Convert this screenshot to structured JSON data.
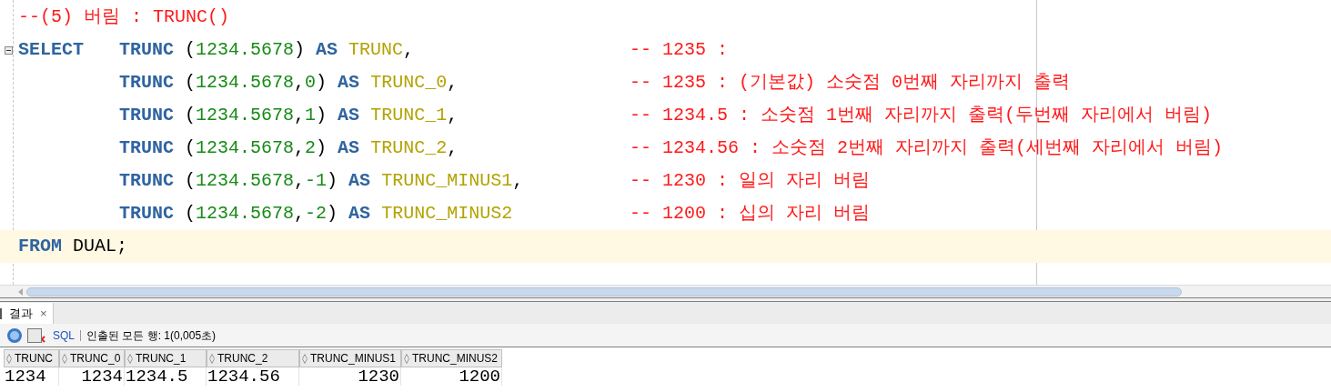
{
  "editor": {
    "lines": [
      {
        "kind": "comment",
        "comment": "--(5) 버림 : TRUNC()"
      },
      {
        "kind": "select",
        "lead": "SELECT",
        "tokens": [
          {
            "kind": "keyword",
            "text": "TRUNC"
          },
          {
            "kind": "plain",
            "text": " ("
          },
          {
            "kind": "number",
            "text": "1234.5678"
          },
          {
            "kind": "plain",
            "text": ") "
          },
          {
            "kind": "keyword",
            "text": "AS"
          },
          {
            "kind": "alias",
            "text": "TRUNC"
          },
          {
            "kind": "plain",
            "text": ","
          }
        ],
        "comment": "-- 1235 :"
      },
      {
        "kind": "continuation",
        "tokens": [
          {
            "kind": "keyword",
            "text": "TRUNC"
          },
          {
            "kind": "plain",
            "text": " ("
          },
          {
            "kind": "number",
            "text": "1234.5678"
          },
          {
            "kind": "plain",
            "text": ","
          },
          {
            "kind": "number",
            "text": "0"
          },
          {
            "kind": "plain",
            "text": ") "
          },
          {
            "kind": "keyword",
            "text": "AS"
          },
          {
            "kind": "alias",
            "text": "TRUNC_0"
          },
          {
            "kind": "plain",
            "text": ","
          }
        ],
        "comment": "-- 1235 : (기본값) 소숫점 0번째 자리까지 출력"
      },
      {
        "kind": "continuation",
        "tokens": [
          {
            "kind": "keyword",
            "text": "TRUNC"
          },
          {
            "kind": "plain",
            "text": " ("
          },
          {
            "kind": "number",
            "text": "1234.5678"
          },
          {
            "kind": "plain",
            "text": ","
          },
          {
            "kind": "number",
            "text": "1"
          },
          {
            "kind": "plain",
            "text": ") "
          },
          {
            "kind": "keyword",
            "text": "AS"
          },
          {
            "kind": "alias",
            "text": "TRUNC_1"
          },
          {
            "kind": "plain",
            "text": ","
          }
        ],
        "comment": "-- 1234.5 : 소숫점 1번째 자리까지 출력(두번째 자리에서 버림)"
      },
      {
        "kind": "continuation",
        "tokens": [
          {
            "kind": "keyword",
            "text": "TRUNC"
          },
          {
            "kind": "plain",
            "text": " ("
          },
          {
            "kind": "number",
            "text": "1234.5678"
          },
          {
            "kind": "plain",
            "text": ","
          },
          {
            "kind": "number",
            "text": "2"
          },
          {
            "kind": "plain",
            "text": ") "
          },
          {
            "kind": "keyword",
            "text": "AS"
          },
          {
            "kind": "alias",
            "text": "TRUNC_2"
          },
          {
            "kind": "plain",
            "text": ","
          }
        ],
        "comment": "-- 1234.56 : 소숫점 2번째 자리까지 출력(세번째 자리에서 버림)"
      },
      {
        "kind": "continuation",
        "tokens": [
          {
            "kind": "keyword",
            "text": "TRUNC"
          },
          {
            "kind": "plain",
            "text": " ("
          },
          {
            "kind": "number",
            "text": "1234.5678"
          },
          {
            "kind": "plain",
            "text": ","
          },
          {
            "kind": "number",
            "text": "-1"
          },
          {
            "kind": "plain",
            "text": ") "
          },
          {
            "kind": "keyword",
            "text": "AS"
          },
          {
            "kind": "alias",
            "text": "TRUNC_MINUS1"
          },
          {
            "kind": "plain",
            "text": ","
          }
        ],
        "comment": "-- 1230 : 일의 자리 버림"
      },
      {
        "kind": "continuation",
        "tokens": [
          {
            "kind": "keyword",
            "text": "TRUNC"
          },
          {
            "kind": "plain",
            "text": " ("
          },
          {
            "kind": "number",
            "text": "1234.5678"
          },
          {
            "kind": "plain",
            "text": ","
          },
          {
            "kind": "number",
            "text": "-2"
          },
          {
            "kind": "plain",
            "text": ") "
          },
          {
            "kind": "keyword",
            "text": "AS"
          },
          {
            "kind": "alias",
            "text": "TRUNC_MINUS2"
          }
        ],
        "comment": "-- 1200 : 십의 자리 버림"
      },
      {
        "kind": "from",
        "tokens": [
          {
            "kind": "keyword",
            "text": "FROM"
          },
          {
            "kind": "plain",
            "text": " DUAL;"
          }
        ],
        "current": true
      }
    ]
  },
  "results": {
    "tab": {
      "label": "결과",
      "close": "×",
      "selected": true
    },
    "toolbar": {
      "sql_link": "SQL",
      "status": "인출된 모든 행: 1(0,005초)"
    },
    "columns": [
      {
        "label": "TRUNC"
      },
      {
        "label": "TRUNC_0"
      },
      {
        "label": "TRUNC_1"
      },
      {
        "label": "TRUNC_2"
      },
      {
        "label": "TRUNC_MINUS1"
      },
      {
        "label": "TRUNC_MINUS2"
      }
    ],
    "rows": [
      [
        "1234",
        "1234",
        "1234.5",
        "1234.56",
        "1230",
        "1200"
      ]
    ]
  }
}
